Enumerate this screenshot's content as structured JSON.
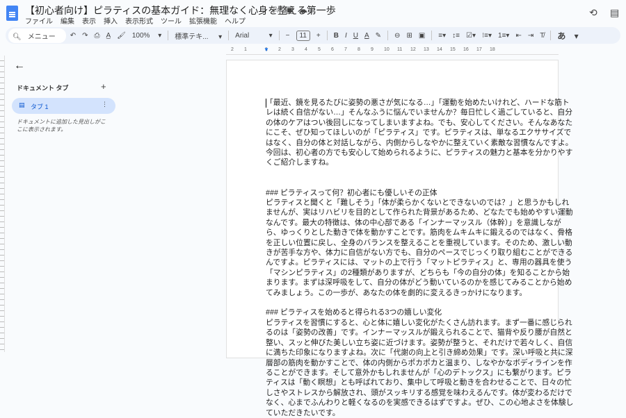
{
  "title": "【初心者向け】ピラティスの基本ガイド：無理なく心身を整える第一歩",
  "menu": [
    "ファイル",
    "編集",
    "表示",
    "挿入",
    "表示形式",
    "ツール",
    "拡張機能",
    "ヘルプ"
  ],
  "toolbar": {
    "search": "メニュー",
    "zoom": "100%",
    "style": "標準テキ...",
    "font": "Arial",
    "size": "11",
    "ime": "あ"
  },
  "ruler": [
    "2",
    "1",
    "1",
    "2",
    "3",
    "4",
    "5",
    "6",
    "7",
    "8",
    "9",
    "10",
    "11",
    "12",
    "13",
    "14",
    "15",
    "16",
    "17",
    "18"
  ],
  "sidebar": {
    "header": "ドキュメント タブ",
    "tab": "タブ 1",
    "hint": "ドキュメントに追加した見出しがここに表示されます。"
  },
  "doc": {
    "p1": [
      "「最近、鏡を見るたびに姿勢の悪さが気になる…」「運動を始めたいけれど、ハードな筋ト",
      "レは続く自信がない…」そんなふうに悩んでいませんか？毎日忙しく過ごしていると、自分",
      "の体のケアはつい後回しになってしまいますよね。でも、安心してください。そんなあなた",
      "にこそ、ぜひ知ってほしいのが「ピラティス」です。ピラティスは、単なるエクササイズで",
      "はなく、自分の体と対話しながら、内側からしなやかに整えていく素敵な習慣なんですよ。",
      "今回は、初心者の方でも安心して始められるように、ピラティスの魅力と基本を分かりやす",
      "くご紹介しますね。"
    ],
    "h2": "### ピラティスって何？初心者にも優しいその正体",
    "p2": [
      "ピラティスと聞くと「難しそう」「体が柔らかくないとできないのでは？」と思うかもしれ",
      "ませんが、実はリハビリを目的として作られた背景があるため、どなたでも始めやすい運動",
      "なんです。最大の特徴は、体の中心部である「インナーマッスル（体幹）」を意識しなが",
      "ら、ゆっくりとした動きで体を動かすことです。筋肉をムキムキに鍛えるのではなく、骨格",
      "を正しい位置に戻し、全身のバランスを整えることを重視しています。そのため、激しい動",
      "きが苦手な方や、体力に自信がない方でも、自分のペースでじっくり取り組むことができる",
      "んですよ。ピラティスには、マットの上で行う「マットピラティス」と、専用の器具を使う",
      "「マシンピラティス」の2種類がありますが、どちらも「今の自分の体」を知ることから始",
      "まります。まずは深呼吸をして、自分の体がどう動いているのかを感じてみることから始め",
      "てみましょう。この一歩が、あなたの体を劇的に変えるきっかけになります。"
    ],
    "h3": "### ピラティスを始めると得られる3つの嬉しい変化",
    "p3": [
      "ピラティスを習慣にすると、心と体に嬉しい変化がたくさん訪れます。まず一番に感じられ",
      "るのは「姿勢の改善」です。インナーマッスルが鍛えられることで、猫背や反り腰が自然と",
      "整い、スッと伸びた美しい立ち姿に近づけます。姿勢が整うと、それだけで若々しく、自信",
      "に満ちた印象になりますよね。次に「代謝の向上と引き締め効果」です。深い呼吸と共に深",
      "層部の筋肉を動かすことで、体の内側からポカポカと温まり、しなやかなボディラインを作",
      "ることができます。そして意外かもしれませんが「心のデトックス」にも繋がります。ピラ",
      "ティスは「動く瞑想」とも呼ばれており、集中して呼吸と動きを合わせることで、日々の忙",
      "しさやストレスから解放され、頭がスッキリする感覚を味わえるんです。体が変わるだけで",
      "なく、心までふんわりと軽くなるのを実感できるはずですよ。ぜひ、この心地よさを体験し",
      "ていただきたいです。"
    ]
  }
}
